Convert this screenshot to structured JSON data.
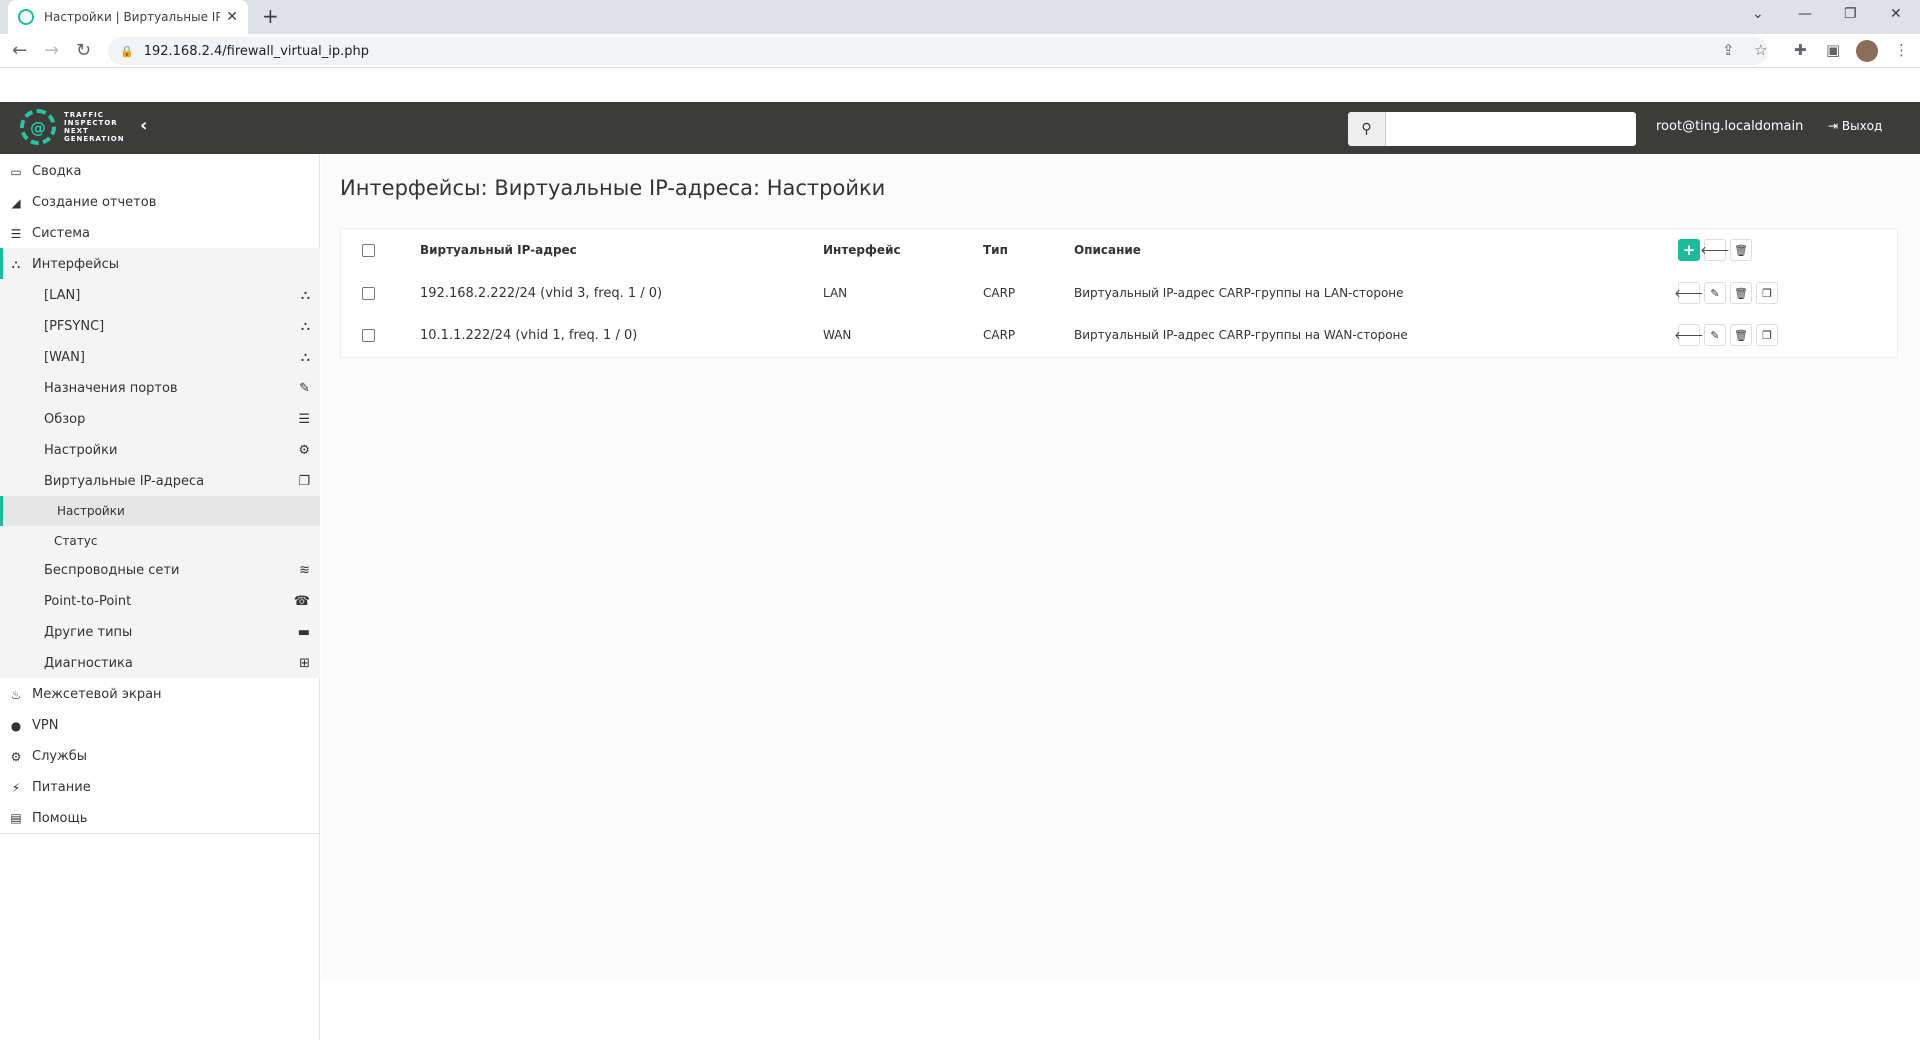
{
  "browser": {
    "tab_title": "Настройки | Виртуальные IP-адреса",
    "url": "192.168.2.4/firewall_virtual_ip.php"
  },
  "header": {
    "logo_text": "TRAFFIC INSPECTOR NEXT GENERATION",
    "search_placeholder": "",
    "user": "root@ting.localdomain",
    "logout": "Выход",
    "accent": "#1abc9c",
    "bar_color": "#3c3c3b"
  },
  "sidebar": {
    "items": [
      {
        "label": "Сводка",
        "icon": "laptop-icon"
      },
      {
        "label": "Создание отчетов",
        "icon": "area-chart-icon"
      },
      {
        "label": "Система",
        "icon": "server-icon"
      },
      {
        "label": "Интерфейсы",
        "icon": "sitemap-icon"
      },
      {
        "label": "Межсетевой экран",
        "icon": "fire-icon"
      },
      {
        "label": "VPN",
        "icon": "globe-icon"
      },
      {
        "label": "Службы",
        "icon": "gear-icon"
      },
      {
        "label": "Питание",
        "icon": "plug-icon"
      },
      {
        "label": "Помощь",
        "icon": "book-icon"
      }
    ],
    "interfaces_sub": [
      {
        "label": "[LAN]",
        "icon": "sitemap-icon"
      },
      {
        "label": "[PFSYNC]",
        "icon": "sitemap-icon"
      },
      {
        "label": "[WAN]",
        "icon": "sitemap-icon"
      },
      {
        "label": "Назначения портов",
        "icon": "pencil-icon"
      },
      {
        "label": "Обзор",
        "icon": "tasks-icon"
      },
      {
        "label": "Настройки",
        "icon": "gears-icon"
      },
      {
        "label": "Виртуальные IP-адреса",
        "icon": "copy-icon"
      },
      {
        "label": "Беспроводные сети",
        "icon": "wifi-icon"
      },
      {
        "label": "Point-to-Point",
        "icon": "phone-icon"
      },
      {
        "label": "Другие типы",
        "icon": "archive-icon"
      },
      {
        "label": "Диагностика",
        "icon": "medkit-icon"
      }
    ],
    "vip_sub": [
      {
        "label": "Настройки",
        "active": true
      },
      {
        "label": "Статус",
        "active": false
      }
    ]
  },
  "main": {
    "title": "Интерфейсы: Виртуальные IP-адреса: Настройки",
    "columns": [
      "Виртуальный IP-адрес",
      "Интерфейс",
      "Тип",
      "Описание"
    ],
    "rows": [
      {
        "address": "192.168.2.222/24 (vhid 3, freq. 1 / 0)",
        "interface": "LAN",
        "type": "CARP",
        "description": "Виртуальный IP-адрес CARP-группы на LAN-стороне"
      },
      {
        "address": "10.1.1.222/24 (vhid 1, freq. 1 / 0)",
        "interface": "WAN",
        "type": "CARP",
        "description": "Виртуальный IP-адрес CARP-группы на WAN-стороне"
      }
    ]
  }
}
